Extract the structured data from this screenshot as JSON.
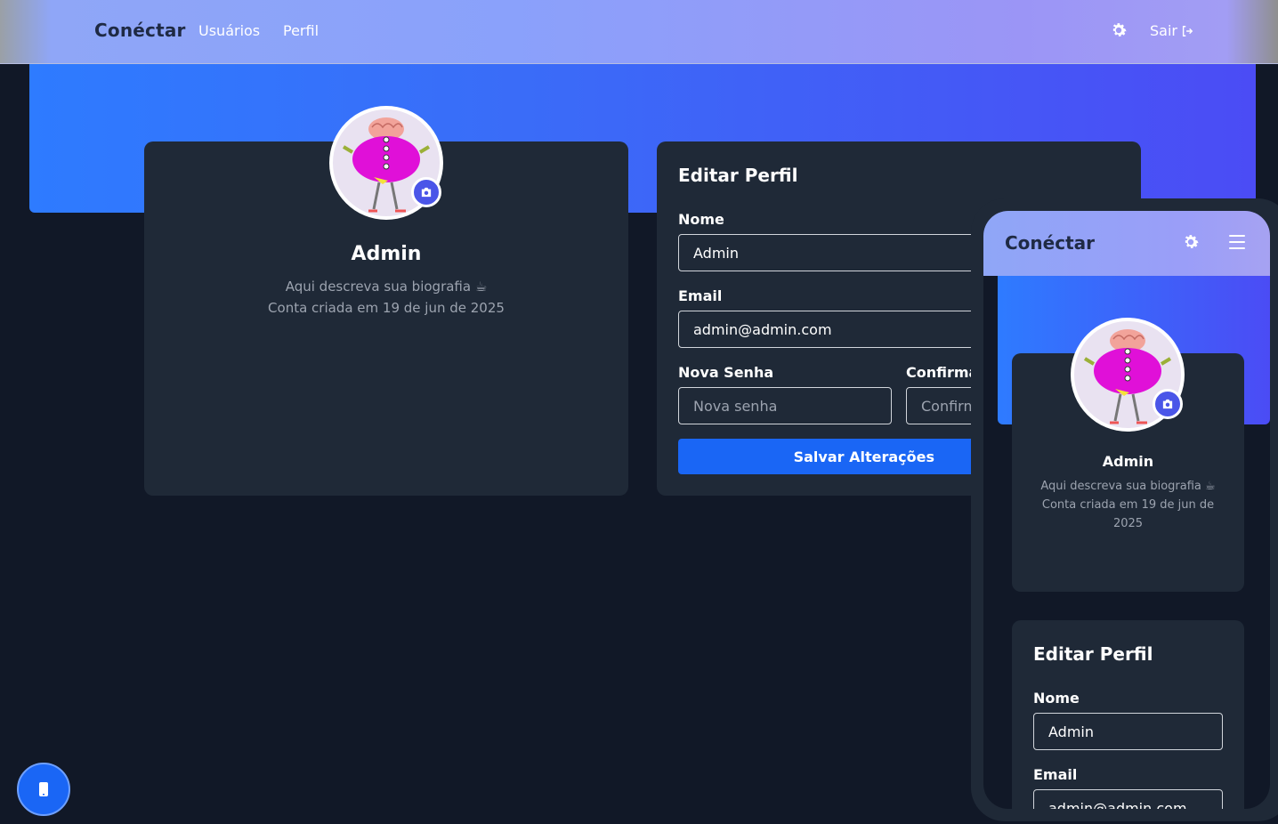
{
  "navbar": {
    "brand": "Conéctar",
    "links": [
      "Usuários",
      "Perfil"
    ],
    "logout_label": "Sair"
  },
  "profile": {
    "name": "Admin",
    "bio": "Aqui descreva sua biografia ☕",
    "created": "Conta criada em 19 de jun de 2025"
  },
  "edit_form": {
    "title": "Editar Perfil",
    "name_label": "Nome",
    "name_value": "Admin",
    "email_label": "Email",
    "email_value": "admin@admin.com",
    "password_label": "Nova Senha",
    "password_placeholder": "Nova senha",
    "confirm_label": "Confirmar Senha",
    "confirm_placeholder": "Confirmar senha",
    "save_label": "Salvar Alterações"
  },
  "mobile_preview": {
    "brand": "Conéctar",
    "created_line1": "Conta criada em 19 de jun de",
    "created_line2": "2025"
  },
  "colors": {
    "accent": "#1a66f5",
    "background": "#111827",
    "card": "#1f2937"
  },
  "icons": {
    "theme": "gear-icon",
    "logout": "logout-icon",
    "camera": "camera-icon",
    "menu": "hamburger-icon",
    "device": "phone-icon"
  }
}
